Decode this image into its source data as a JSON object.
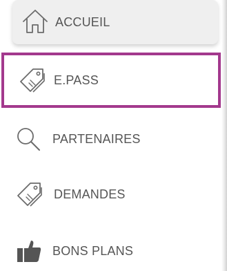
{
  "nav": {
    "items": [
      {
        "label": "ACCUEIL",
        "icon": "home-icon",
        "state": "hovered"
      },
      {
        "label": "E.PASS",
        "icon": "tags-icon",
        "state": "selected"
      },
      {
        "label": "PARTENAIRES",
        "icon": "search-icon",
        "state": "default"
      },
      {
        "label": "DEMANDES",
        "icon": "tags-icon",
        "state": "default"
      },
      {
        "label": "BONS PLANS",
        "icon": "thumbs-up-icon",
        "state": "default"
      }
    ]
  },
  "colors": {
    "highlight_border": "#a3398d",
    "hover_background": "#efefef",
    "text": "#555555",
    "icon": "#6b6b6b"
  }
}
